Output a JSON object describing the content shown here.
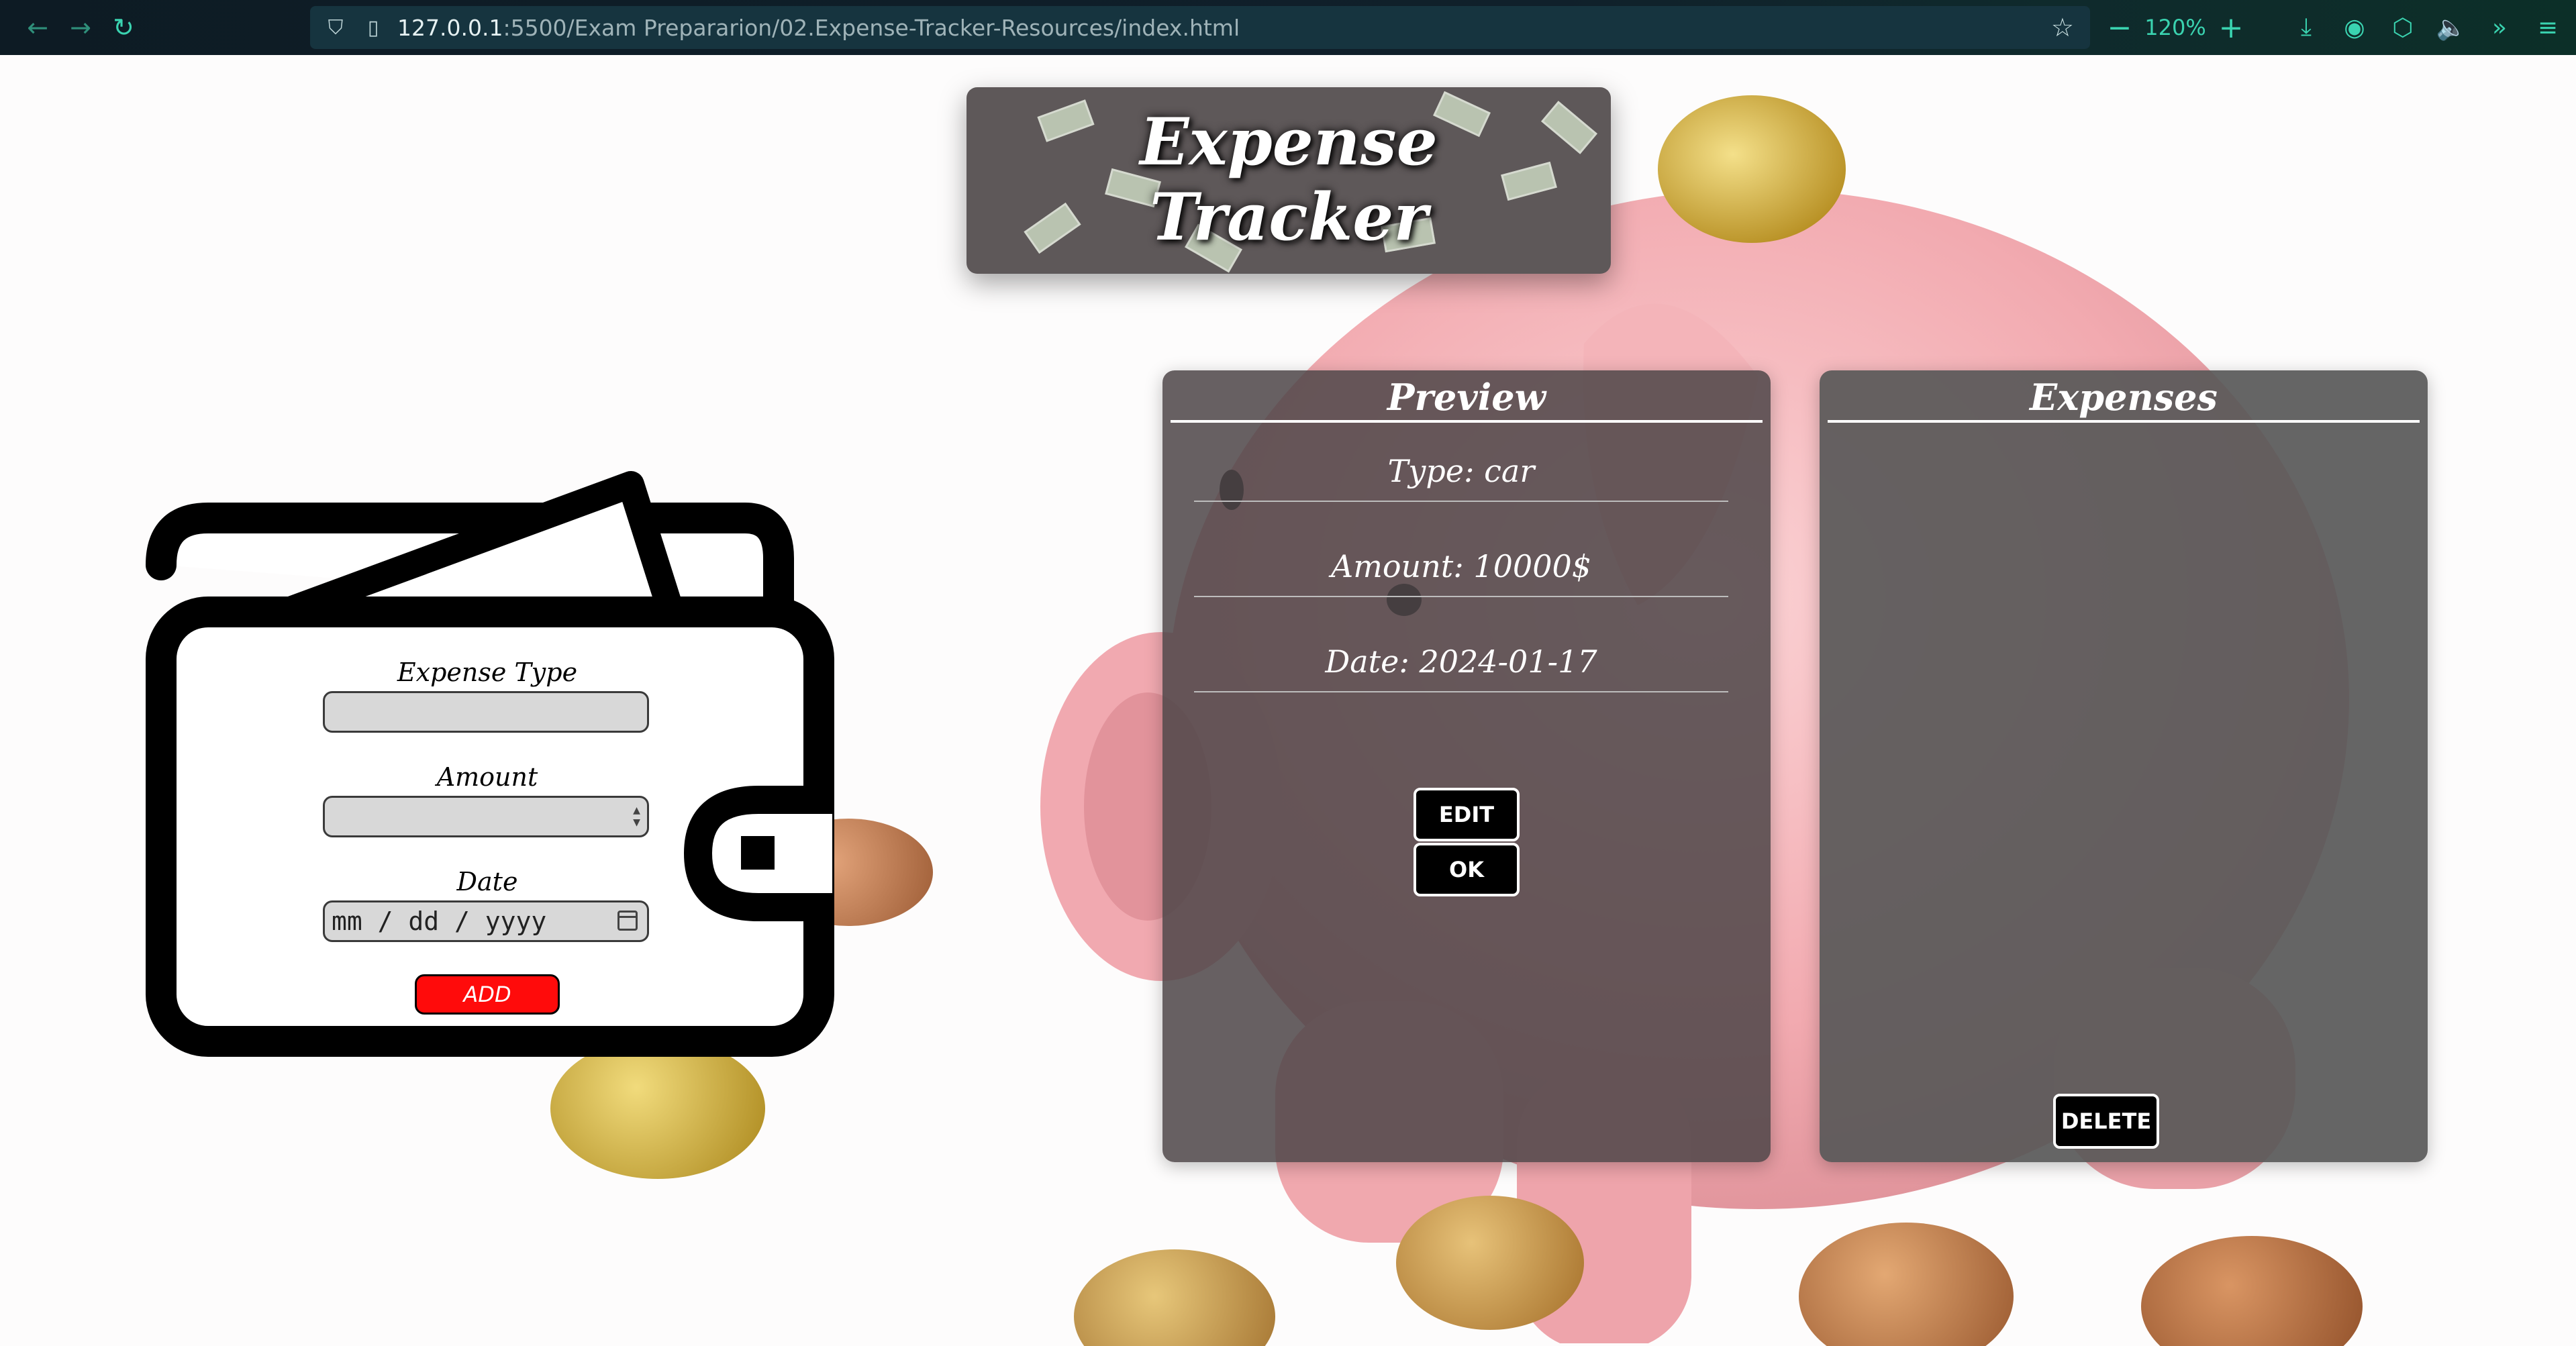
{
  "browser": {
    "url_host": "127.0.0.1",
    "url_path": ":5500/Exam Prepararion/02.Expense-Tracker-Resources/index.html",
    "zoom": "120%",
    "icons": [
      "back-arrow-icon",
      "forward-arrow-icon",
      "reload-icon",
      "shield-icon",
      "page-icon",
      "star-icon",
      "download-icon",
      "account-icon",
      "extensions-icon",
      "speaker-icon",
      "more-tools-icon",
      "menu-icon"
    ]
  },
  "header": {
    "title_line1": "Expense",
    "title_line2": "Tracker"
  },
  "form": {
    "type_label": "Expense Type",
    "type_value": "",
    "amount_label": "Amount",
    "amount_value": "",
    "date_label": "Date",
    "date_placeholder": "mm / dd / yyyy",
    "add_label": "ADD"
  },
  "preview": {
    "title": "Preview",
    "type": "Type: car",
    "amount": "Amount: 10000$",
    "date": "Date: 2024-01-17",
    "edit_label": "EDIT",
    "ok_label": "OK"
  },
  "expenses": {
    "title": "Expenses",
    "delete_label": "DELETE"
  },
  "colors": {
    "add_button": "#ff0b0b",
    "panel_bg": "#585858",
    "pig_pink": "#f4b2b6",
    "accent": "#3ad3b0"
  }
}
